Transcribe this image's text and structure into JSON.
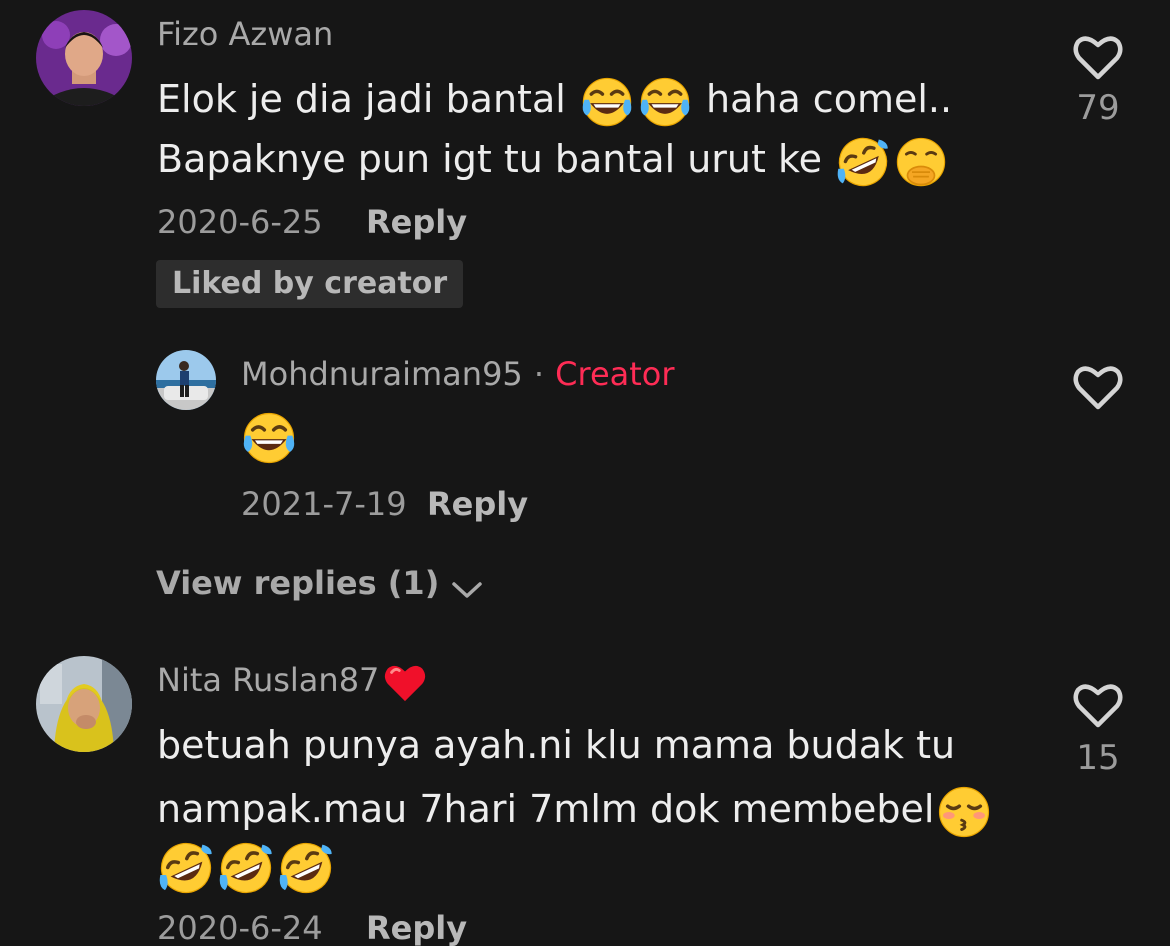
{
  "comments": [
    {
      "username": "Fizo Azwan",
      "text_line1_a": "Elok je dia jadi bantal",
      "text_line1_b": "haha comel..",
      "text_line2": "Bapaknye pun igt tu bantal urut ke",
      "date": "2020-6-25",
      "reply_label": "Reply",
      "liked_badge": "Liked by creator",
      "like_count": "79",
      "emojis_line1": [
        "face-with-tears-of-joy",
        "face-with-tears-of-joy"
      ],
      "emojis_line2": [
        "rolling-on-floor-laughing",
        "face-with-hand-over-mouth"
      ]
    },
    {
      "username": "Nita Ruslan87",
      "username_emoji": "red-heart",
      "text_line1": "betuah punya ayah.ni klu mama budak tu",
      "text_line2": "nampak.mau 7hari 7mlm dok membebel",
      "date": "2020-6-24",
      "reply_label": "Reply",
      "like_count": "15",
      "emojis_line2": [
        "kissing-face-with-closed-eyes"
      ],
      "emojis_line3": [
        "rolling-on-floor-laughing",
        "rolling-on-floor-laughing",
        "rolling-on-floor-laughing"
      ]
    }
  ],
  "reply": {
    "username": "Mohdnuraiman95",
    "separator": "·",
    "creator_label": "Creator",
    "emojis": [
      "face-with-tears-of-joy"
    ],
    "date": "2021-7-19",
    "reply_label": "Reply"
  },
  "view_replies": {
    "label": "View replies (1)"
  },
  "colors": {
    "background": "#161616",
    "creator": "#fe2c55",
    "text": "#ededed",
    "muted": "#9c9c9c"
  }
}
